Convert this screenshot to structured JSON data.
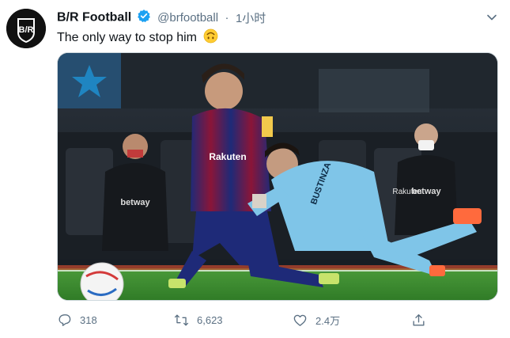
{
  "account": {
    "name": "B/R Football",
    "handle": "@brfootball",
    "time": "1小时",
    "avatar_text": "B/R"
  },
  "tweet": {
    "text": "The only way to stop him"
  },
  "media": {
    "jersey_labels": [
      "Rakuten",
      "BUSTINZA",
      "betway",
      "betway",
      "Rakuten"
    ]
  },
  "actions": {
    "reply_count": "318",
    "retweet_count": "6,623",
    "like_count": "2.4万"
  },
  "colors": {
    "accent": "#1da1f2",
    "muted": "#5b7083",
    "pitch": "#3b8f2e"
  },
  "icons": [
    "verified-badge-icon",
    "chevron-down-icon",
    "upside-down-face-emoji-icon",
    "reply-icon",
    "retweet-icon",
    "like-icon",
    "share-icon"
  ]
}
